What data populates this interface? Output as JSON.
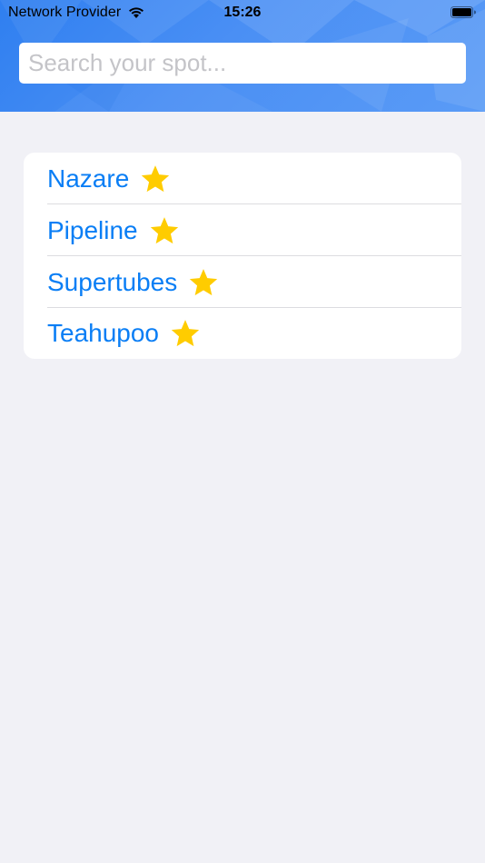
{
  "status_bar": {
    "carrier": "Network Provider",
    "time": "15:26"
  },
  "search": {
    "placeholder": "Search your spot...",
    "value": ""
  },
  "spots": [
    {
      "name": "Nazare",
      "favorite": true
    },
    {
      "name": "Pipeline",
      "favorite": true
    },
    {
      "name": "Supertubes",
      "favorite": true
    },
    {
      "name": "Teahupoo",
      "favorite": true
    }
  ],
  "colors": {
    "header": "#3a86f2",
    "link": "#0a7ef5",
    "star": "#ffcc00",
    "background": "#f1f1f6"
  },
  "icons": {
    "wifi": "wifi-icon",
    "battery": "battery-icon",
    "favorite": "star-icon"
  }
}
